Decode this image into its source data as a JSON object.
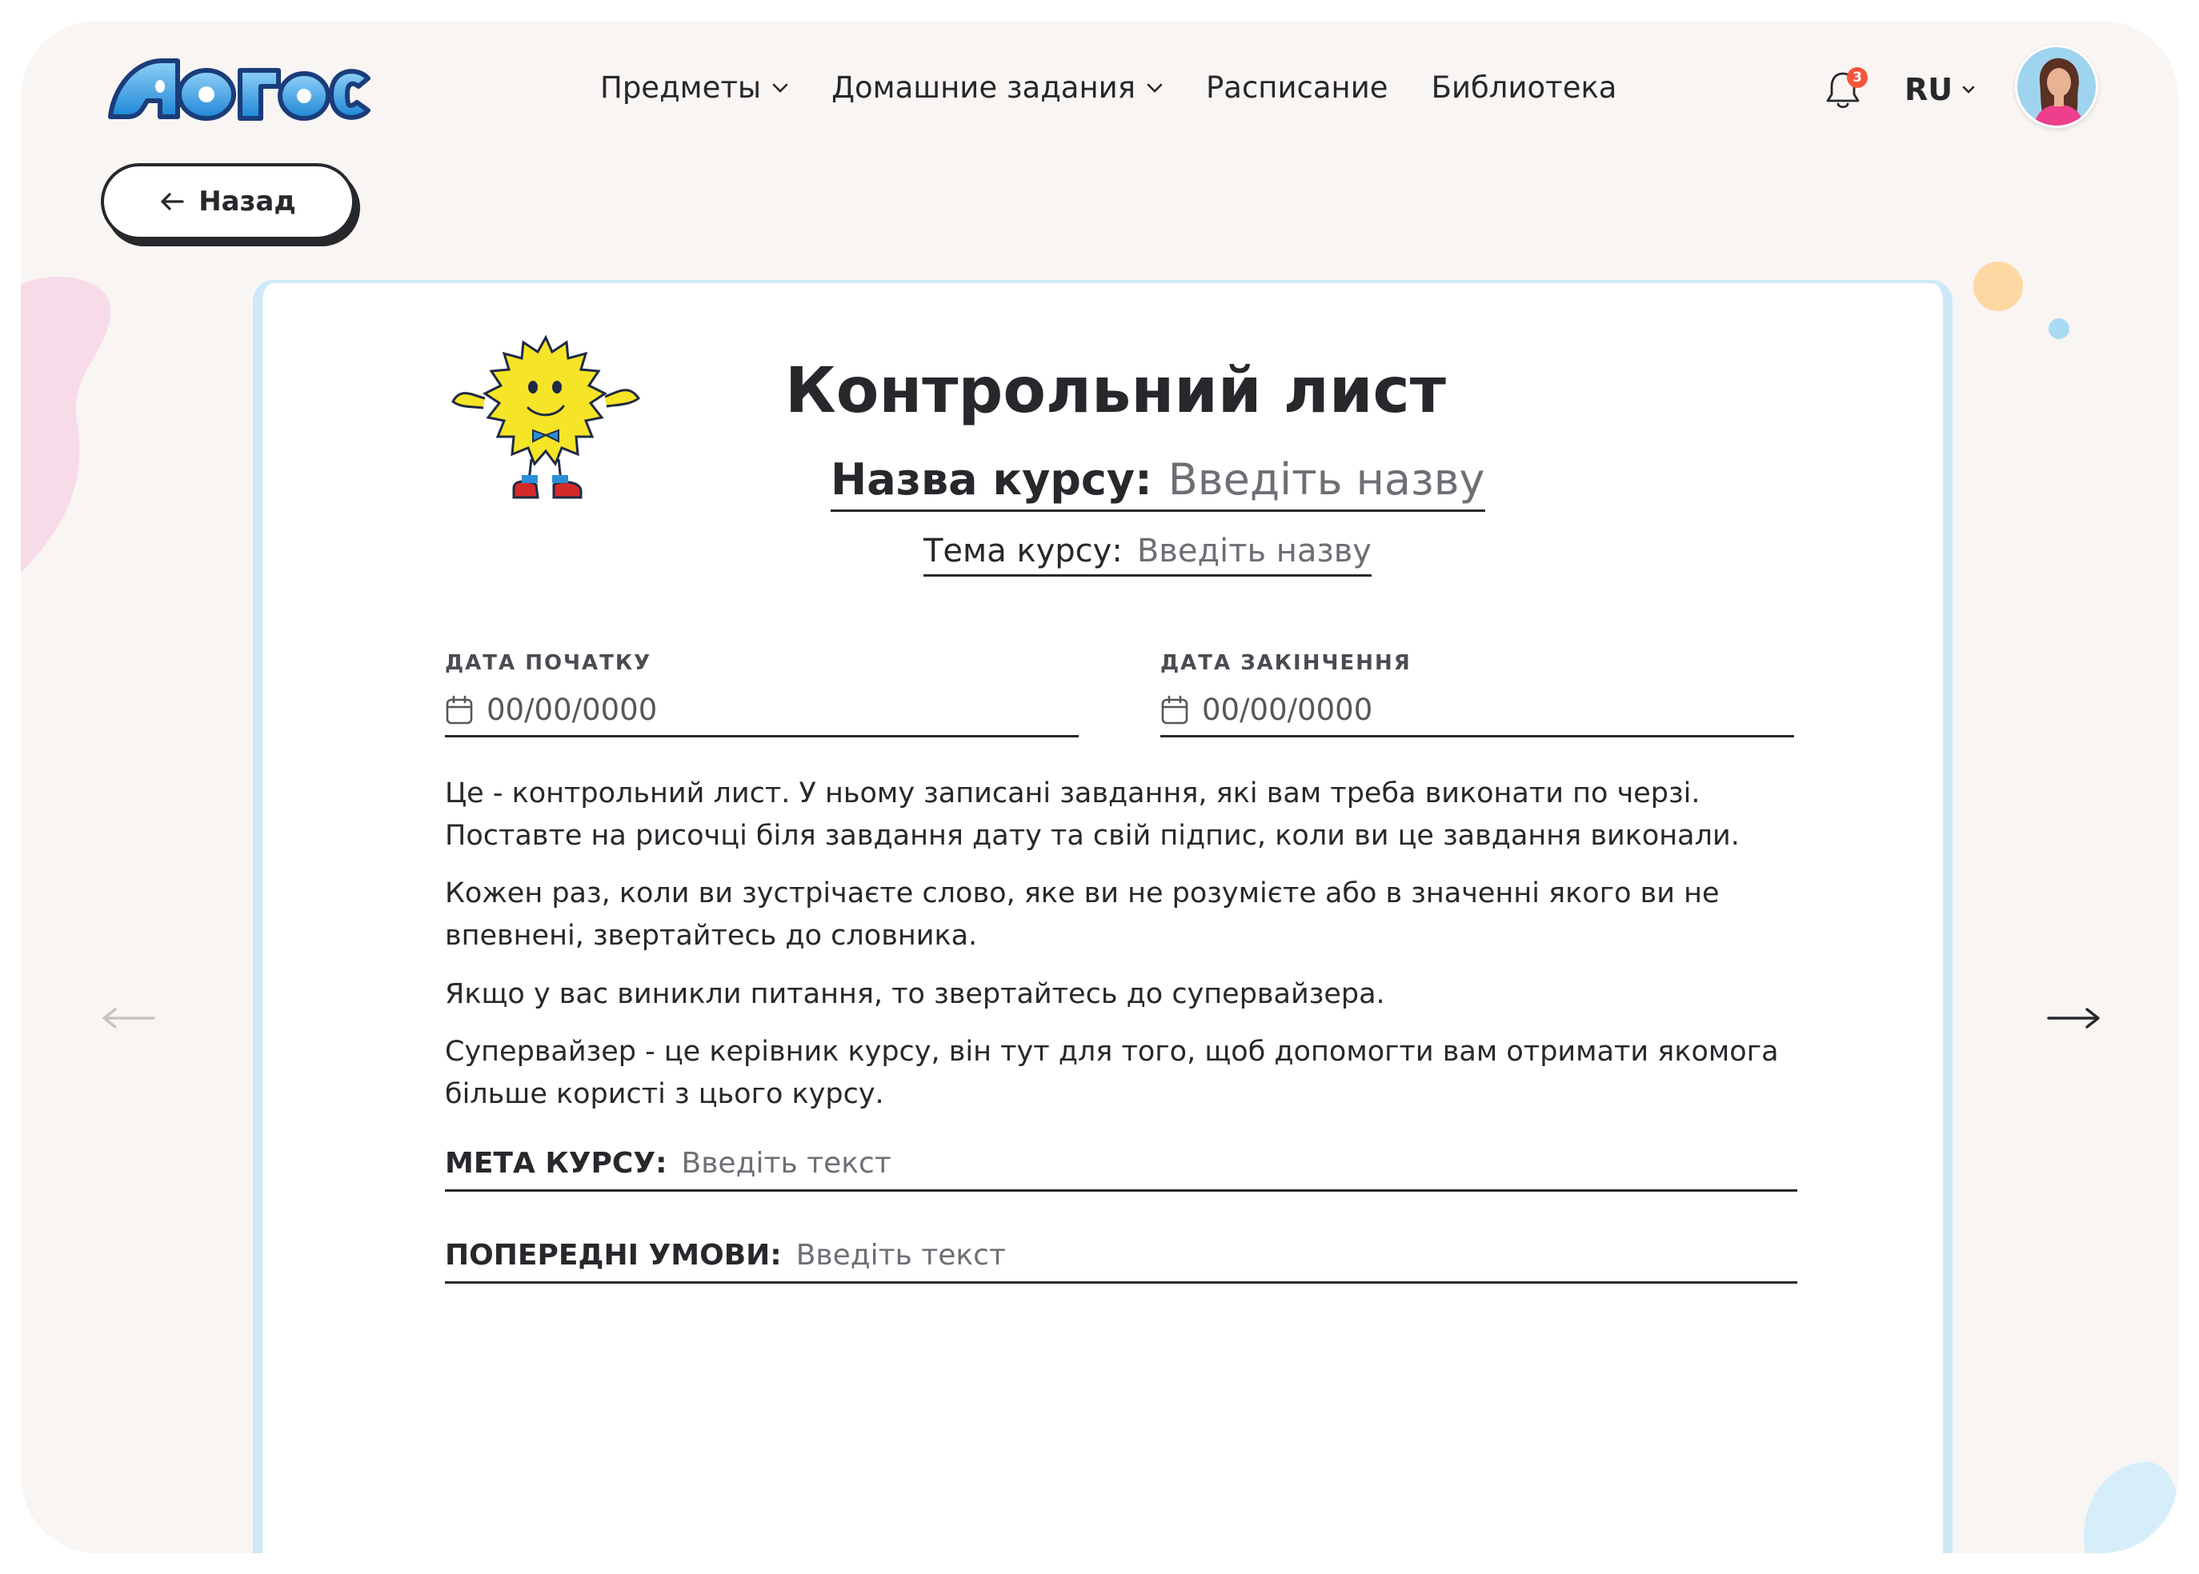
{
  "header": {
    "logo_alt": "Логос",
    "nav": [
      {
        "label": "Предметы",
        "has_dropdown": true
      },
      {
        "label": "Домашние задания",
        "has_dropdown": true
      },
      {
        "label": "Расписание",
        "has_dropdown": false
      },
      {
        "label": "Библиотека",
        "has_dropdown": false
      }
    ],
    "notifications_count": "3",
    "language": "RU"
  },
  "back_button": {
    "label": "Назад"
  },
  "card": {
    "title": "Контрольний лист",
    "course_name": {
      "label": "Назва курсу:",
      "placeholder": "Введіть назву"
    },
    "course_topic": {
      "label": "Тема курсу:",
      "placeholder": "Введіть назву"
    },
    "start_date": {
      "label": "ДАТА ПОЧАТКУ",
      "placeholder": "00/00/0000"
    },
    "end_date": {
      "label": "ДАТА ЗАКІНЧЕННЯ",
      "placeholder": "00/00/0000"
    },
    "paragraphs": [
      "Це - контрольний лист. У ньому записані завдання, які вам треба виконати по черзі. Поставте на рисочці біля завдання дату та свій підпис, коли ви це завдання виконали.",
      "Кожен раз, коли ви зустрічаєте слово, яке ви не розумієте або в значенні якого ви не впевнені, звертайтесь до словника.",
      "Якщо у вас виникли питання, то звертайтесь до супервайзера.",
      "Супервайзер - це керівник курсу, він тут для того, щоб допомогти вам отримати якомога більше користі з цього курсу."
    ],
    "goal": {
      "label": "МЕТА КУРСУ:",
      "placeholder": "Введіть текст"
    },
    "prerequisites": {
      "label": "ПОПЕРЕДНІ УМОВИ:",
      "placeholder": "Введіть текст"
    }
  },
  "colors": {
    "text": "#26282c",
    "placeholder": "#6d6f75",
    "card_border": "#cde9f8",
    "logo_blue": "#3aa2e6",
    "badge": "#f5553a",
    "page_bg": "#f8f5f3"
  },
  "icons": [
    "bell-icon",
    "chevron-down-icon",
    "arrow-left-icon",
    "arrow-right-icon",
    "calendar-icon"
  ]
}
